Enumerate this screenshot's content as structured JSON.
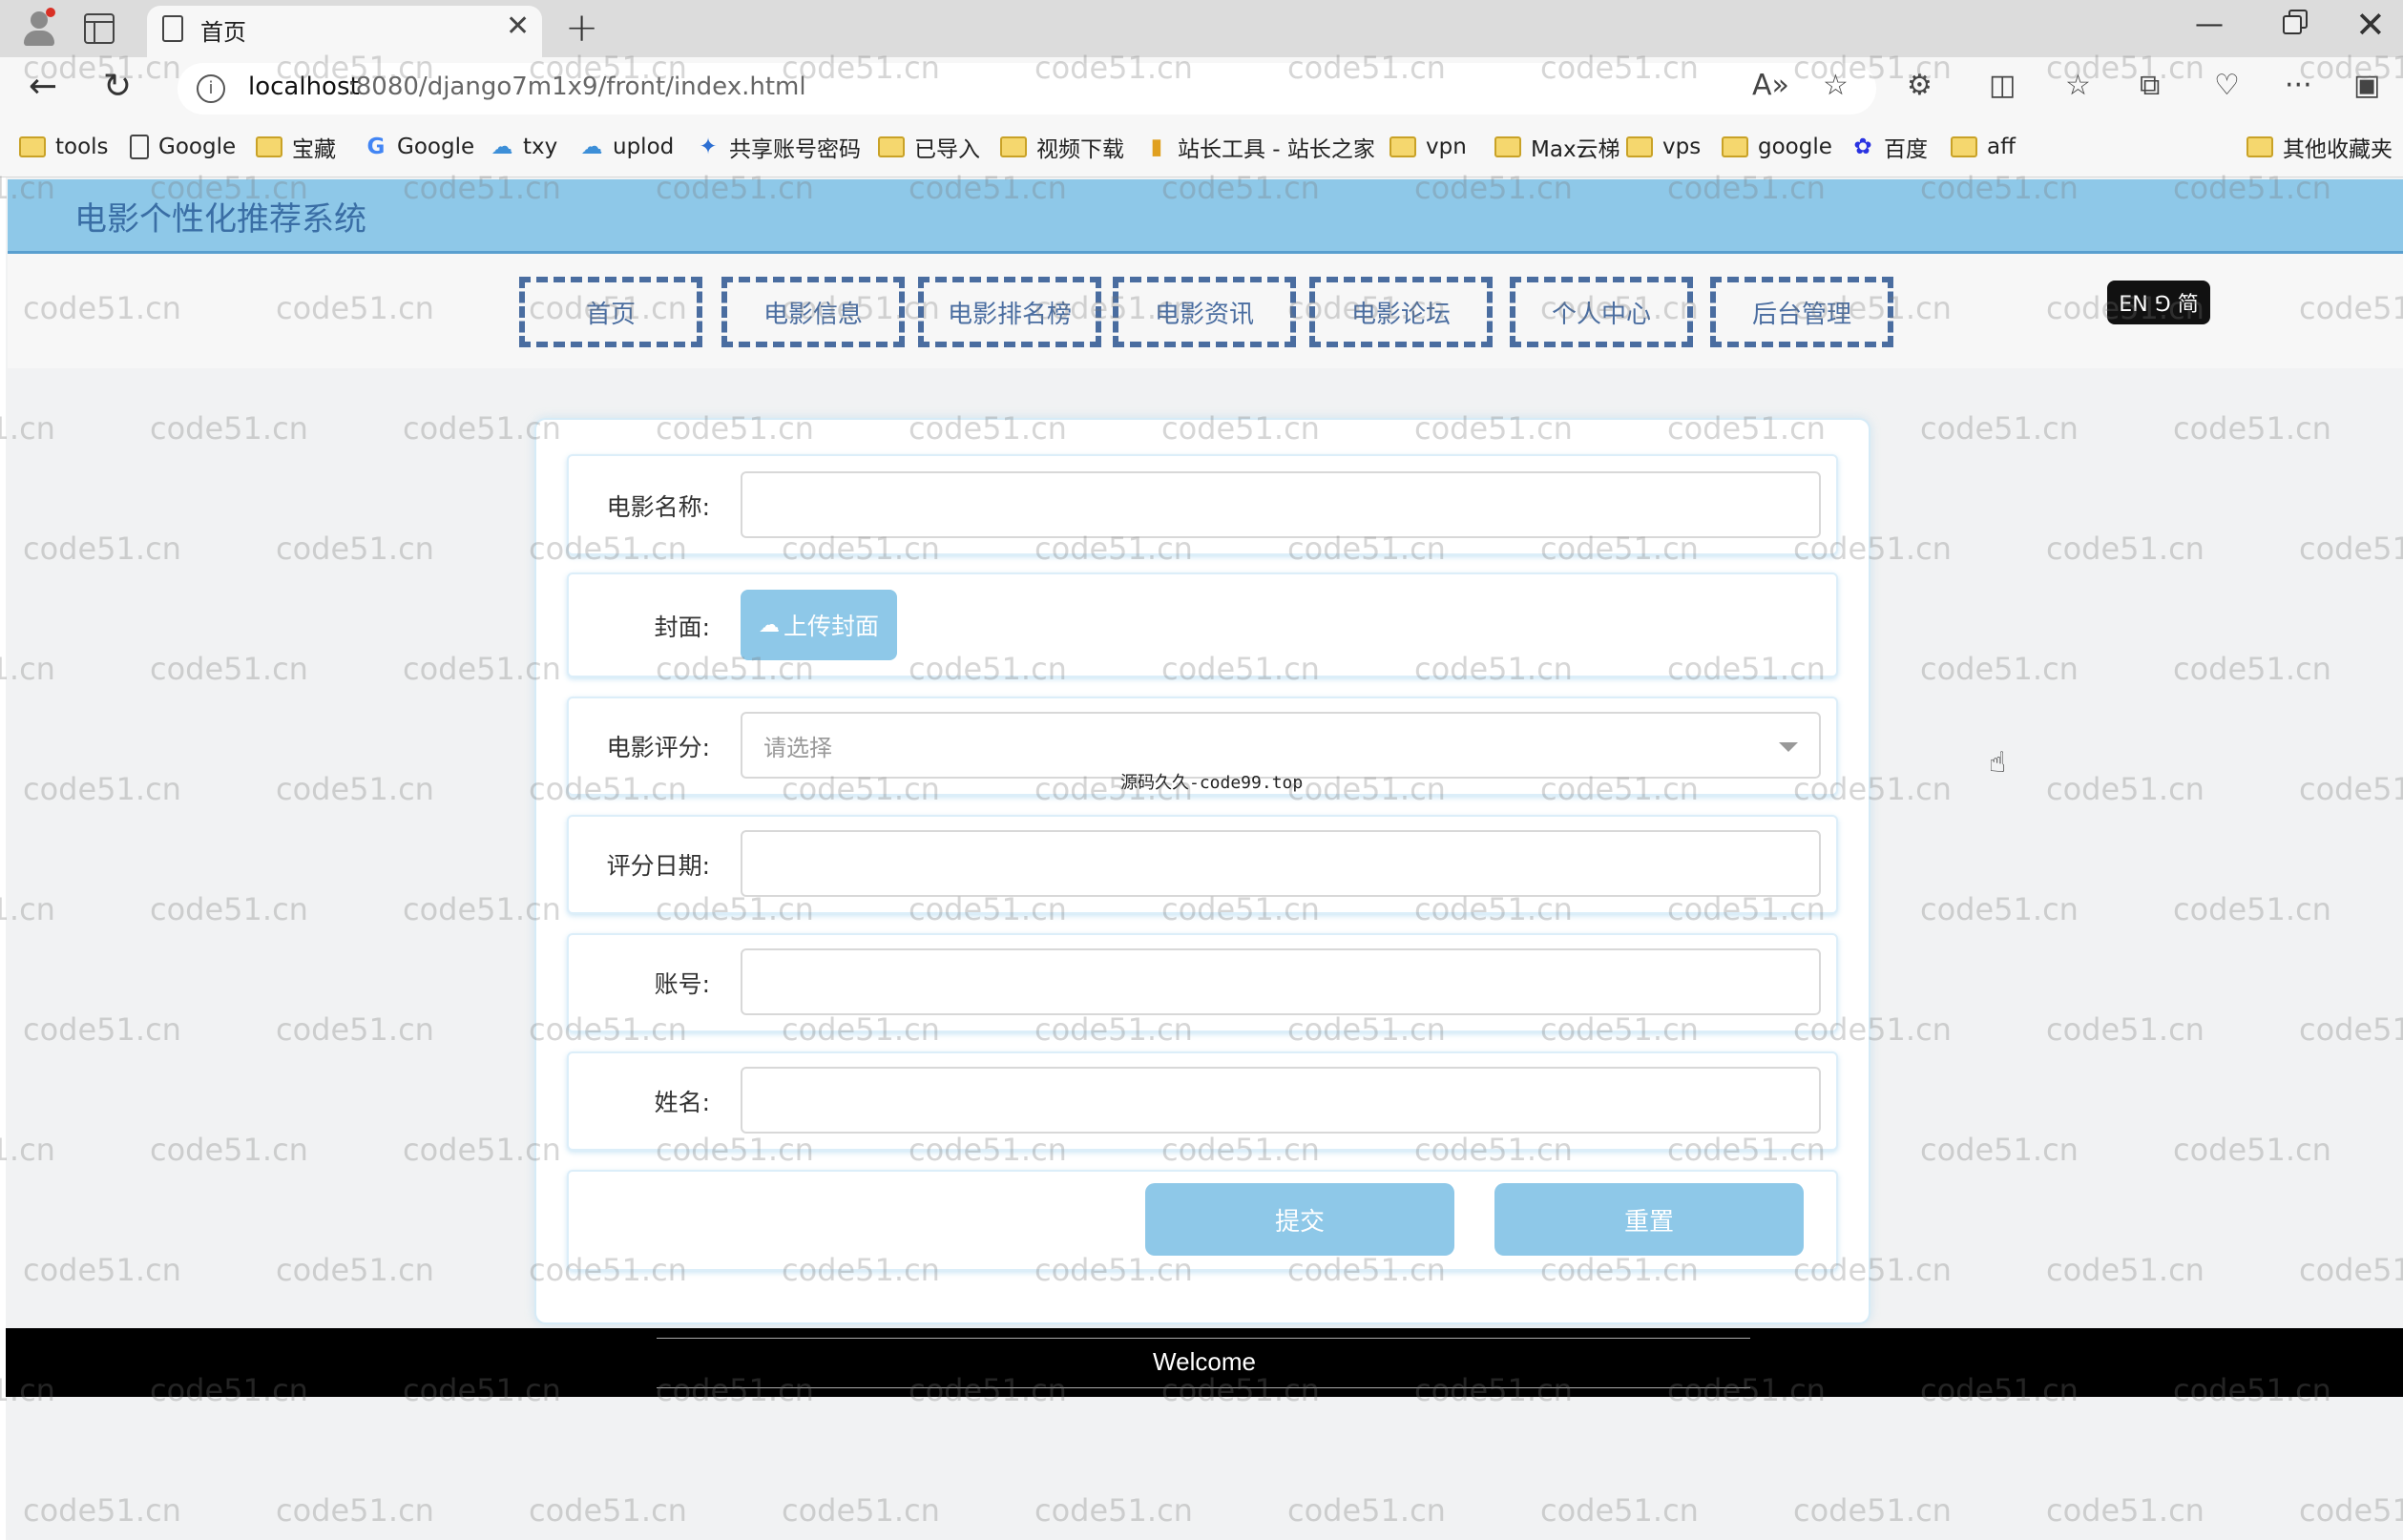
{
  "browser": {
    "tab_title": "首页",
    "tab_close": "✕",
    "new_tab": "+",
    "url_host": "localhost",
    "url_path": ":8080/django7m1x9/front/index.html",
    "window_controls": {
      "minimize": "—",
      "close": "✕"
    },
    "toolbar_icons": [
      "read-aloud-icon",
      "favorite-star-icon",
      "extensions-icon",
      "split-screen-icon",
      "favorites-icon",
      "collections-icon",
      "browser-health-icon",
      "more-icon",
      "sidebar-icon"
    ],
    "toolbar_glyphs": [
      "A»",
      "☆",
      "⚙",
      "◫",
      "☆",
      "⧉",
      "♡",
      "···",
      "▣"
    ]
  },
  "bookmarks": [
    {
      "label": "tools",
      "icon": "folder-icon"
    },
    {
      "label": "Google",
      "icon": "page-icon"
    },
    {
      "label": "宝藏",
      "icon": "folder-icon"
    },
    {
      "label": "Google",
      "icon": "google-icon",
      "glyph": "G"
    },
    {
      "label": "txy",
      "icon": "cloud-icon",
      "glyph": "☁"
    },
    {
      "label": "uplod",
      "icon": "cloud-icon",
      "glyph": "☁"
    },
    {
      "label": "共享账号密码",
      "icon": "share-icon",
      "glyph": "✦"
    },
    {
      "label": "已导入",
      "icon": "folder-icon"
    },
    {
      "label": "视频下载",
      "icon": "folder-icon"
    },
    {
      "label": "站长工具 - 站长之家",
      "icon": "chart-icon",
      "glyph": "▮"
    },
    {
      "label": "vpn",
      "icon": "folder-icon"
    },
    {
      "label": "Max云梯",
      "icon": "folder-icon"
    },
    {
      "label": "vps",
      "icon": "folder-icon"
    },
    {
      "label": "google",
      "icon": "folder-icon"
    },
    {
      "label": "百度",
      "icon": "baidu-icon",
      "glyph": "✿"
    },
    {
      "label": "aff",
      "icon": "folder-icon"
    },
    {
      "label": "其他收藏夹",
      "icon": "folder-icon"
    }
  ],
  "site": {
    "title": "电影个性化推荐系统",
    "nav": [
      "首页",
      "电影信息",
      "电影排名榜",
      "电影资讯",
      "电影论坛",
      "个人中心",
      "后台管理"
    ],
    "lang_toggle": "EN ⅁ 简"
  },
  "form": {
    "movie_name_label": "电影名称:",
    "movie_name_value": "",
    "cover_label": "封面:",
    "upload_button": "上传封面",
    "rating_label": "电影评分:",
    "rating_placeholder": "请选择",
    "date_label": "评分日期:",
    "date_value": "",
    "account_label": "账号:",
    "account_value": "",
    "name_label": "姓名:",
    "name_value": "",
    "submit_button": "提交",
    "reset_button": "重置"
  },
  "overlay_note": "源码久久-code99.top",
  "footer": {
    "text": "Welcome"
  },
  "watermark": "code51.cn",
  "colors": {
    "header_bg": "#8ec8e8",
    "nav_text": "#4a6da0",
    "button_bg": "#8ec8e8",
    "footer_bg": "#000000"
  }
}
